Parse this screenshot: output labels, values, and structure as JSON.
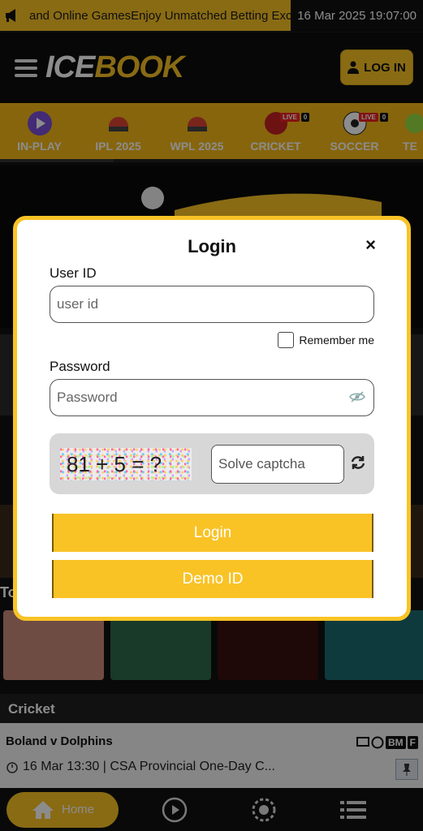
{
  "ticker": {
    "text": "and Online GamesEnjoy Unmatched Betting Excitem",
    "datetime": "16 Mar 2025 19:07:00"
  },
  "header": {
    "logo_part1": "ICE",
    "logo_part2": "BOOK",
    "login_label": "LOG IN"
  },
  "sports": [
    {
      "label": "IN-PLAY",
      "icon": "play-icon"
    },
    {
      "label": "IPL 2025",
      "icon": "cricket-helmet-icon"
    },
    {
      "label": "WPL 2025",
      "icon": "cricket-helmet-icon"
    },
    {
      "label": "CRICKET",
      "icon": "cricket-ball-icon",
      "live": "LIVE",
      "count": "0"
    },
    {
      "label": "SOCCER",
      "icon": "soccer-ball-icon",
      "live": "LIVE",
      "count": "0"
    },
    {
      "label": "TE",
      "icon": "tennis-ball-icon"
    }
  ],
  "section": {
    "cricket": "Cricket",
    "top_partial": "To"
  },
  "match": {
    "title": "Boland v Dolphins",
    "time": "16 Mar 13:30 | CSA Provincial One-Day C...",
    "badges": [
      "BM",
      "F"
    ]
  },
  "bottomnav": {
    "home_label": "Home"
  },
  "modal": {
    "title": "Login",
    "close": "×",
    "user_label": "User ID",
    "user_placeholder": "user id",
    "remember_label": "Remember me",
    "password_label": "Password",
    "password_placeholder": "Password",
    "captcha_text": "81 + 5 = ?",
    "captcha_placeholder": "Solve captcha",
    "login_button": "Login",
    "demo_button": "Demo ID"
  },
  "colors": {
    "accent": "#f9c326",
    "dark": "#111111"
  }
}
